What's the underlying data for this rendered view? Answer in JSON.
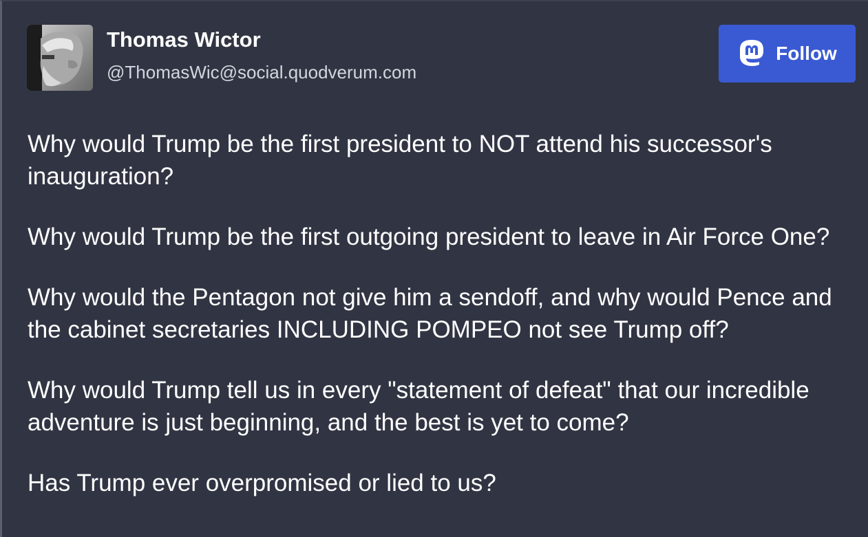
{
  "author": {
    "display_name": "Thomas Wictor",
    "handle": "@ThomasWic@social.quodverum.com"
  },
  "follow_button": {
    "label": "Follow",
    "icon": "mastodon-icon",
    "color": "#3a5ad4"
  },
  "post": {
    "paragraphs": [
      "Why would Trump be the first president to NOT attend his successor's inauguration?",
      "Why would Trump be the first outgoing president to leave in Air Force One?",
      "Why would the Pentagon not give him a sendoff, and why would Pence and the cabinet secretaries INCLUDING POMPEO not see Trump off?",
      "Why would Trump tell us in every \"statement of defeat\" that our incredible adventure is just beginning, and the best is yet to come?",
      "Has Trump ever overpromised or lied to us?"
    ]
  },
  "colors": {
    "background": "#313543",
    "text": "#ffffff",
    "handle_text": "#d3d6de"
  }
}
